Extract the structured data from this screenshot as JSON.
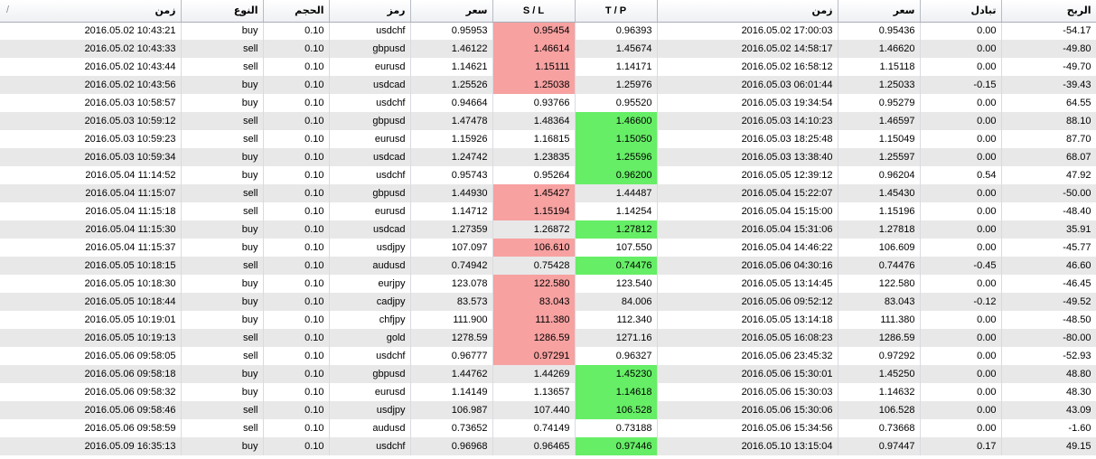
{
  "header": {
    "open_time": "زمن",
    "type": "النوع",
    "volume": "الحجم",
    "symbol": "رمز",
    "open_price": "سعر",
    "sl": "S / L",
    "tp": "T / P",
    "close_time": "زمن",
    "close_price": "سعر",
    "swap": "تبادل",
    "profit": "الربح",
    "sort_indicator": "/"
  },
  "colors": {
    "sl_hit": "#f7a1a1",
    "tp_hit": "#66ee66",
    "row_alt": "#e8e8e8"
  },
  "rows": [
    {
      "open_time": "2016.05.02 10:43:21",
      "type": "buy",
      "volume": "0.10",
      "symbol": "usdchf",
      "open_price": "0.95953",
      "sl": "0.95454",
      "tp": "0.96393",
      "close_time": "2016.05.02 17:00:03",
      "close_price": "0.95436",
      "swap": "0.00",
      "profit": "-54.17",
      "hit": "sl"
    },
    {
      "open_time": "2016.05.02 10:43:33",
      "type": "sell",
      "volume": "0.10",
      "symbol": "gbpusd",
      "open_price": "1.46122",
      "sl": "1.46614",
      "tp": "1.45674",
      "close_time": "2016.05.02 14:58:17",
      "close_price": "1.46620",
      "swap": "0.00",
      "profit": "-49.80",
      "hit": "sl"
    },
    {
      "open_time": "2016.05.02 10:43:44",
      "type": "sell",
      "volume": "0.10",
      "symbol": "eurusd",
      "open_price": "1.14621",
      "sl": "1.15111",
      "tp": "1.14171",
      "close_time": "2016.05.02 16:58:12",
      "close_price": "1.15118",
      "swap": "0.00",
      "profit": "-49.70",
      "hit": "sl"
    },
    {
      "open_time": "2016.05.02 10:43:56",
      "type": "buy",
      "volume": "0.10",
      "symbol": "usdcad",
      "open_price": "1.25526",
      "sl": "1.25038",
      "tp": "1.25976",
      "close_time": "2016.05.03 06:01:44",
      "close_price": "1.25033",
      "swap": "-0.15",
      "profit": "-39.43",
      "hit": "sl"
    },
    {
      "open_time": "2016.05.03 10:58:57",
      "type": "buy",
      "volume": "0.10",
      "symbol": "usdchf",
      "open_price": "0.94664",
      "sl": "0.93766",
      "tp": "0.95520",
      "close_time": "2016.05.03 19:34:54",
      "close_price": "0.95279",
      "swap": "0.00",
      "profit": "64.55",
      "hit": ""
    },
    {
      "open_time": "2016.05.03 10:59:12",
      "type": "sell",
      "volume": "0.10",
      "symbol": "gbpusd",
      "open_price": "1.47478",
      "sl": "1.48364",
      "tp": "1.46600",
      "close_time": "2016.05.03 14:10:23",
      "close_price": "1.46597",
      "swap": "0.00",
      "profit": "88.10",
      "hit": "tp"
    },
    {
      "open_time": "2016.05.03 10:59:23",
      "type": "sell",
      "volume": "0.10",
      "symbol": "eurusd",
      "open_price": "1.15926",
      "sl": "1.16815",
      "tp": "1.15050",
      "close_time": "2016.05.03 18:25:48",
      "close_price": "1.15049",
      "swap": "0.00",
      "profit": "87.70",
      "hit": "tp"
    },
    {
      "open_time": "2016.05.03 10:59:34",
      "type": "buy",
      "volume": "0.10",
      "symbol": "usdcad",
      "open_price": "1.24742",
      "sl": "1.23835",
      "tp": "1.25596",
      "close_time": "2016.05.03 13:38:40",
      "close_price": "1.25597",
      "swap": "0.00",
      "profit": "68.07",
      "hit": "tp"
    },
    {
      "open_time": "2016.05.04 11:14:52",
      "type": "buy",
      "volume": "0.10",
      "symbol": "usdchf",
      "open_price": "0.95743",
      "sl": "0.95264",
      "tp": "0.96200",
      "close_time": "2016.05.05 12:39:12",
      "close_price": "0.96204",
      "swap": "0.54",
      "profit": "47.92",
      "hit": "tp"
    },
    {
      "open_time": "2016.05.04 11:15:07",
      "type": "sell",
      "volume": "0.10",
      "symbol": "gbpusd",
      "open_price": "1.44930",
      "sl": "1.45427",
      "tp": "1.44487",
      "close_time": "2016.05.04 15:22:07",
      "close_price": "1.45430",
      "swap": "0.00",
      "profit": "-50.00",
      "hit": "sl"
    },
    {
      "open_time": "2016.05.04 11:15:18",
      "type": "sell",
      "volume": "0.10",
      "symbol": "eurusd",
      "open_price": "1.14712",
      "sl": "1.15194",
      "tp": "1.14254",
      "close_time": "2016.05.04 15:15:00",
      "close_price": "1.15196",
      "swap": "0.00",
      "profit": "-48.40",
      "hit": "sl"
    },
    {
      "open_time": "2016.05.04 11:15:30",
      "type": "buy",
      "volume": "0.10",
      "symbol": "usdcad",
      "open_price": "1.27359",
      "sl": "1.26872",
      "tp": "1.27812",
      "close_time": "2016.05.04 15:31:06",
      "close_price": "1.27818",
      "swap": "0.00",
      "profit": "35.91",
      "hit": "tp"
    },
    {
      "open_time": "2016.05.04 11:15:37",
      "type": "buy",
      "volume": "0.10",
      "symbol": "usdjpy",
      "open_price": "107.097",
      "sl": "106.610",
      "tp": "107.550",
      "close_time": "2016.05.04 14:46:22",
      "close_price": "106.609",
      "swap": "0.00",
      "profit": "-45.77",
      "hit": "sl"
    },
    {
      "open_time": "2016.05.05 10:18:15",
      "type": "sell",
      "volume": "0.10",
      "symbol": "audusd",
      "open_price": "0.74942",
      "sl": "0.75428",
      "tp": "0.74476",
      "close_time": "2016.05.06 04:30:16",
      "close_price": "0.74476",
      "swap": "-0.45",
      "profit": "46.60",
      "hit": "tp"
    },
    {
      "open_time": "2016.05.05 10:18:30",
      "type": "buy",
      "volume": "0.10",
      "symbol": "eurjpy",
      "open_price": "123.078",
      "sl": "122.580",
      "tp": "123.540",
      "close_time": "2016.05.05 13:14:45",
      "close_price": "122.580",
      "swap": "0.00",
      "profit": "-46.45",
      "hit": "sl"
    },
    {
      "open_time": "2016.05.05 10:18:44",
      "type": "buy",
      "volume": "0.10",
      "symbol": "cadjpy",
      "open_price": "83.573",
      "sl": "83.043",
      "tp": "84.006",
      "close_time": "2016.05.06 09:52:12",
      "close_price": "83.043",
      "swap": "-0.12",
      "profit": "-49.52",
      "hit": "sl"
    },
    {
      "open_time": "2016.05.05 10:19:01",
      "type": "buy",
      "volume": "0.10",
      "symbol": "chfjpy",
      "open_price": "111.900",
      "sl": "111.380",
      "tp": "112.340",
      "close_time": "2016.05.05 13:14:18",
      "close_price": "111.380",
      "swap": "0.00",
      "profit": "-48.50",
      "hit": "sl"
    },
    {
      "open_time": "2016.05.05 10:19:13",
      "type": "sell",
      "volume": "0.10",
      "symbol": "gold",
      "open_price": "1278.59",
      "sl": "1286.59",
      "tp": "1271.16",
      "close_time": "2016.05.05 16:08:23",
      "close_price": "1286.59",
      "swap": "0.00",
      "profit": "-80.00",
      "hit": "sl"
    },
    {
      "open_time": "2016.05.06 09:58:05",
      "type": "sell",
      "volume": "0.10",
      "symbol": "usdchf",
      "open_price": "0.96777",
      "sl": "0.97291",
      "tp": "0.96327",
      "close_time": "2016.05.06 23:45:32",
      "close_price": "0.97292",
      "swap": "0.00",
      "profit": "-52.93",
      "hit": "sl"
    },
    {
      "open_time": "2016.05.06 09:58:18",
      "type": "buy",
      "volume": "0.10",
      "symbol": "gbpusd",
      "open_price": "1.44762",
      "sl": "1.44269",
      "tp": "1.45230",
      "close_time": "2016.05.06 15:30:01",
      "close_price": "1.45250",
      "swap": "0.00",
      "profit": "48.80",
      "hit": "tp"
    },
    {
      "open_time": "2016.05.06 09:58:32",
      "type": "buy",
      "volume": "0.10",
      "symbol": "eurusd",
      "open_price": "1.14149",
      "sl": "1.13657",
      "tp": "1.14618",
      "close_time": "2016.05.06 15:30:03",
      "close_price": "1.14632",
      "swap": "0.00",
      "profit": "48.30",
      "hit": "tp"
    },
    {
      "open_time": "2016.05.06 09:58:46",
      "type": "sell",
      "volume": "0.10",
      "symbol": "usdjpy",
      "open_price": "106.987",
      "sl": "107.440",
      "tp": "106.528",
      "close_time": "2016.05.06 15:30:06",
      "close_price": "106.528",
      "swap": "0.00",
      "profit": "43.09",
      "hit": "tp"
    },
    {
      "open_time": "2016.05.06 09:58:59",
      "type": "sell",
      "volume": "0.10",
      "symbol": "audusd",
      "open_price": "0.73652",
      "sl": "0.74149",
      "tp": "0.73188",
      "close_time": "2016.05.06 15:34:56",
      "close_price": "0.73668",
      "swap": "0.00",
      "profit": "-1.60",
      "hit": ""
    },
    {
      "open_time": "2016.05.09 16:35:13",
      "type": "buy",
      "volume": "0.10",
      "symbol": "usdchf",
      "open_price": "0.96968",
      "sl": "0.96465",
      "tp": "0.97446",
      "close_time": "2016.05.10 13:15:04",
      "close_price": "0.97447",
      "swap": "0.17",
      "profit": "49.15",
      "hit": "tp"
    }
  ]
}
